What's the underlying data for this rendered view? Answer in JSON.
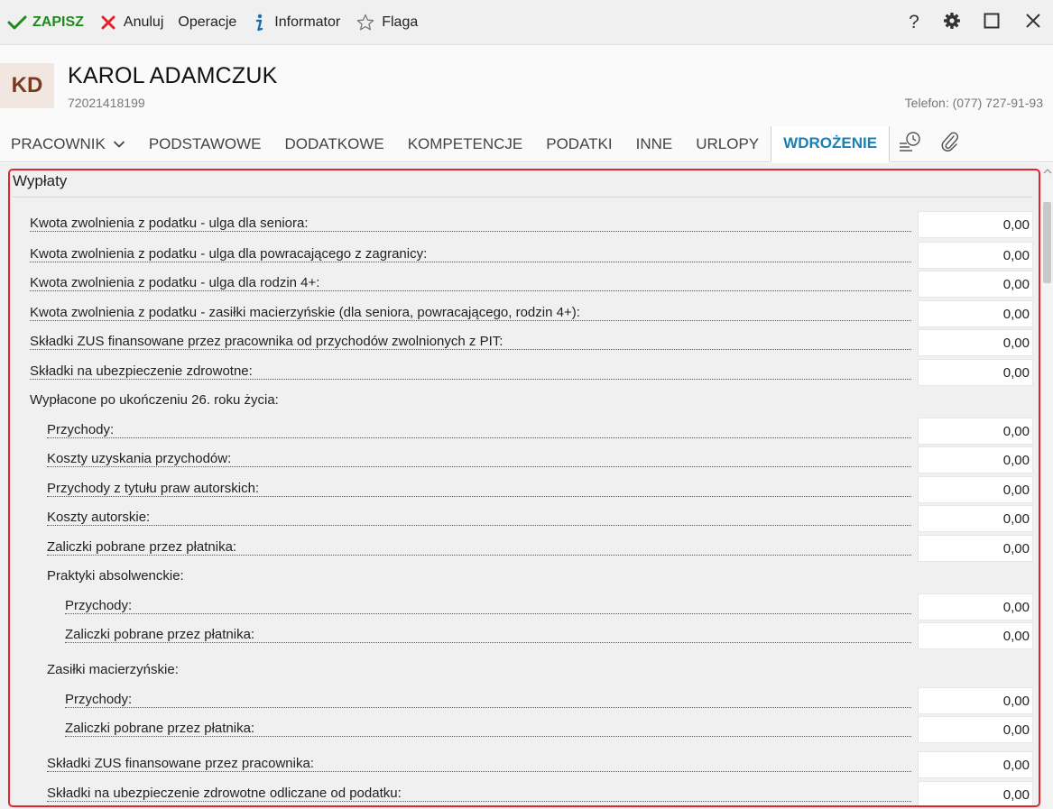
{
  "toolbar": {
    "save": "ZAPISZ",
    "cancel": "Anuluj",
    "operations": "Operacje",
    "informator": "Informator",
    "flag": "Flaga",
    "help": "?",
    "icons": [
      "check-icon",
      "x-icon",
      "info-icon",
      "star-icon",
      "gear-icon",
      "maximize-icon",
      "close-icon"
    ]
  },
  "header": {
    "initials": "KD",
    "name": "KAROL ADAMCZUK",
    "pesel": "72021418199",
    "phone": "Telefon: (077) 727-91-93"
  },
  "tabs": [
    {
      "label": "PRACOWNIK",
      "dropdown": true
    },
    {
      "label": "PODSTAWOWE"
    },
    {
      "label": "DODATKOWE"
    },
    {
      "label": "KOMPETENCJE"
    },
    {
      "label": "PODATKI"
    },
    {
      "label": "INNE"
    },
    {
      "label": "URLOPY"
    },
    {
      "label": "WDROŻENIE",
      "active": true
    }
  ],
  "section": {
    "title": "Wypłaty",
    "rows": [
      {
        "label": "Kwota zwolnienia z podatku - ulga dla seniora:",
        "value": "0,00"
      },
      {
        "label": "Kwota zwolnienia z podatku - ulga dla powracającego z zagranicy:",
        "value": "0,00"
      },
      {
        "label": "Kwota zwolnienia z podatku - ulga dla rodzin 4+:",
        "value": "0,00"
      },
      {
        "label": "Kwota zwolnienia z podatku - zasiłki macierzyńskie (dla seniora, powracającego, rodzin 4+):",
        "value": "0,00"
      },
      {
        "label": "Składki ZUS finansowane przez pracownika od przychodów zwolnionych z PIT:",
        "value": "0,00"
      },
      {
        "label": "Składki na ubezpieczenie zdrowotne:",
        "value": "0,00"
      },
      {
        "label": "Wypłacone po ukończeniu 26. roku życia:"
      },
      {
        "label": "Przychody:",
        "value": "0,00"
      },
      {
        "label": "Koszty uzyskania przychodów:",
        "value": "0,00"
      },
      {
        "label": "Przychody z tytułu praw autorskich:",
        "value": "0,00"
      },
      {
        "label": "Koszty autorskie:",
        "value": "0,00"
      },
      {
        "label": "Zaliczki pobrane przez płatnika:",
        "value": "0,00"
      },
      {
        "label": "Praktyki absolwenckie:"
      },
      {
        "label": "Przychody:",
        "value": "0,00"
      },
      {
        "label": "Zaliczki pobrane przez płatnika:",
        "value": "0,00"
      },
      {
        "label": "Zasiłki macierzyńskie:"
      },
      {
        "label": "Przychody:",
        "value": "0,00"
      },
      {
        "label": "Zaliczki pobrane przez płatnika:",
        "value": "0,00"
      },
      {
        "label": "Składki ZUS finansowane przez pracownika:",
        "value": "0,00"
      },
      {
        "label": "Składki na ubezpieczenie zdrowotne odliczane od podatku:",
        "value": "0,00"
      }
    ]
  },
  "colors": {
    "accent": "#1a7fb5",
    "save_green": "#1e8a1e",
    "cancel_red": "#e1252f",
    "frame_red": "#e1252f",
    "avatar_bg": "#f2e6e0",
    "avatar_text": "#7a3a22"
  }
}
